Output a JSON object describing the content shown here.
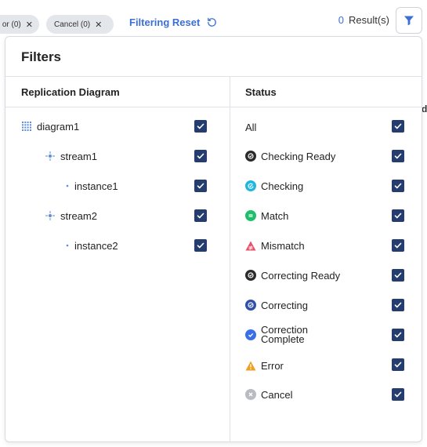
{
  "topbar": {
    "chips": [
      {
        "label": "or (0)"
      },
      {
        "label": "Cancel (0)"
      }
    ],
    "reset_label": "Filtering Reset",
    "results_count": "0",
    "results_label": "Result(s)"
  },
  "background": {
    "partial_text": "d"
  },
  "filters": {
    "title": "Filters",
    "replication": {
      "header": "Replication Diagram",
      "items": [
        {
          "label": "diagram1",
          "checked": true
        },
        {
          "label": "stream1",
          "checked": true
        },
        {
          "label": "instance1",
          "checked": true
        },
        {
          "label": "stream2",
          "checked": true
        },
        {
          "label": "instance2",
          "checked": true
        }
      ]
    },
    "status": {
      "header": "Status",
      "items": [
        {
          "label": "All",
          "checked": true
        },
        {
          "label": "Checking Ready",
          "icon": "checking-ready-icon",
          "color": "#2b2b2b",
          "checked": true
        },
        {
          "label": "Checking",
          "icon": "checking-icon",
          "color": "#1fb7e0",
          "checked": true
        },
        {
          "label": "Match",
          "icon": "match-icon",
          "color": "#1fbf6a",
          "checked": true
        },
        {
          "label": "Mismatch",
          "icon": "mismatch-icon",
          "color": "#e8506a",
          "checked": true
        },
        {
          "label": "Correcting Ready",
          "icon": "correcting-ready-icon",
          "color": "#2b2b2b",
          "checked": true
        },
        {
          "label": "Correcting",
          "icon": "correcting-icon",
          "color": "#2f4fa8",
          "checked": true
        },
        {
          "label": "Correction Complete",
          "line1": "Correction",
          "line2": "Complete",
          "icon": "correction-complete-icon",
          "color": "#3b6fe8",
          "checked": true
        },
        {
          "label": "Error",
          "icon": "error-icon",
          "color": "#f0a020",
          "checked": true
        },
        {
          "label": "Cancel",
          "icon": "cancel-icon",
          "color": "#b8bcc2",
          "checked": true
        }
      ]
    }
  },
  "colors": {
    "accent": "#3b6fd6",
    "checkbox": "#253c6e",
    "chip_bg": "#e3e6ea"
  }
}
